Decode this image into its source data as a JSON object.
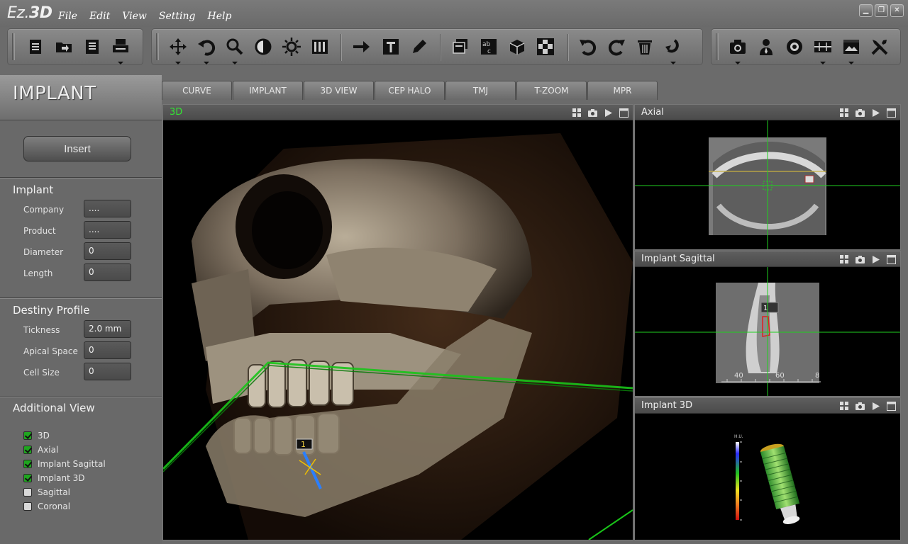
{
  "app": {
    "logo_prefix": "Ez.",
    "logo_suffix": "3D"
  },
  "menu": [
    "File",
    "Edit",
    "View",
    "Setting",
    "Help"
  ],
  "window_controls": {
    "minimize": "▁",
    "restore": "❐",
    "close": "✕"
  },
  "toolbar": {
    "groups": [
      [
        "new-document-icon",
        "open-folder-icon",
        "save-icon",
        "print-icon"
      ],
      [
        "move-icon",
        "rotate-icon",
        "zoom-icon",
        "contrast-icon",
        "brightness-icon",
        "layout-columns-icon",
        "arrow-icon",
        "text-icon",
        "pencil-icon",
        "layers-icon",
        "abc-label-icon",
        "cube-icon",
        "checker-icon",
        "undo-icon",
        "redo-icon",
        "trash-icon",
        "reset-icon"
      ],
      [
        "camera-icon",
        "patient-icon",
        "disc-icon",
        "compare-icon",
        "image-icon",
        "tools-icon"
      ]
    ]
  },
  "mode": {
    "title": "IMPLANT"
  },
  "tabs": [
    "CURVE",
    "IMPLANT",
    "3D VIEW",
    "CEP HALO",
    "TMJ",
    "T-ZOOM",
    "MPR"
  ],
  "left_panel": {
    "insert_label": "Insert",
    "implant": {
      "title": "Implant",
      "fields": [
        {
          "label": "Company",
          "value": "...."
        },
        {
          "label": "Product",
          "value": "...."
        },
        {
          "label": "Diameter",
          "value": "0"
        },
        {
          "label": "Length",
          "value": "0"
        }
      ]
    },
    "density": {
      "title": "Destiny Profile",
      "fields": [
        {
          "label": "Tickness",
          "value": "2.0 mm"
        },
        {
          "label": "Apical Space",
          "value": "0"
        },
        {
          "label": "Cell Size",
          "value": "0"
        }
      ]
    },
    "additional": {
      "title": "Additional View",
      "items": [
        {
          "label": "3D",
          "checked": true
        },
        {
          "label": "Axial",
          "checked": true
        },
        {
          "label": "Implant Sagittal",
          "checked": true
        },
        {
          "label": "Implant 3D",
          "checked": true
        },
        {
          "label": "Sagittal",
          "checked": false
        },
        {
          "label": "Coronal",
          "checked": false
        }
      ]
    }
  },
  "views": {
    "main": {
      "title": "3D",
      "title_color": "#33e633",
      "implant_marker": "1"
    },
    "axial": {
      "title": "Axial"
    },
    "sagittal": {
      "title": "Implant Sagittal",
      "marker": "1",
      "ruler_labels": [
        "40",
        "60",
        "8"
      ]
    },
    "implant3d": {
      "title": "Implant 3D",
      "scale_label": "H.U."
    }
  },
  "colors": {
    "crosshair": "#1fd11f",
    "plane": "#19c419",
    "implant_axis": "#2a7fff",
    "implant_cross": "#f0c000"
  }
}
